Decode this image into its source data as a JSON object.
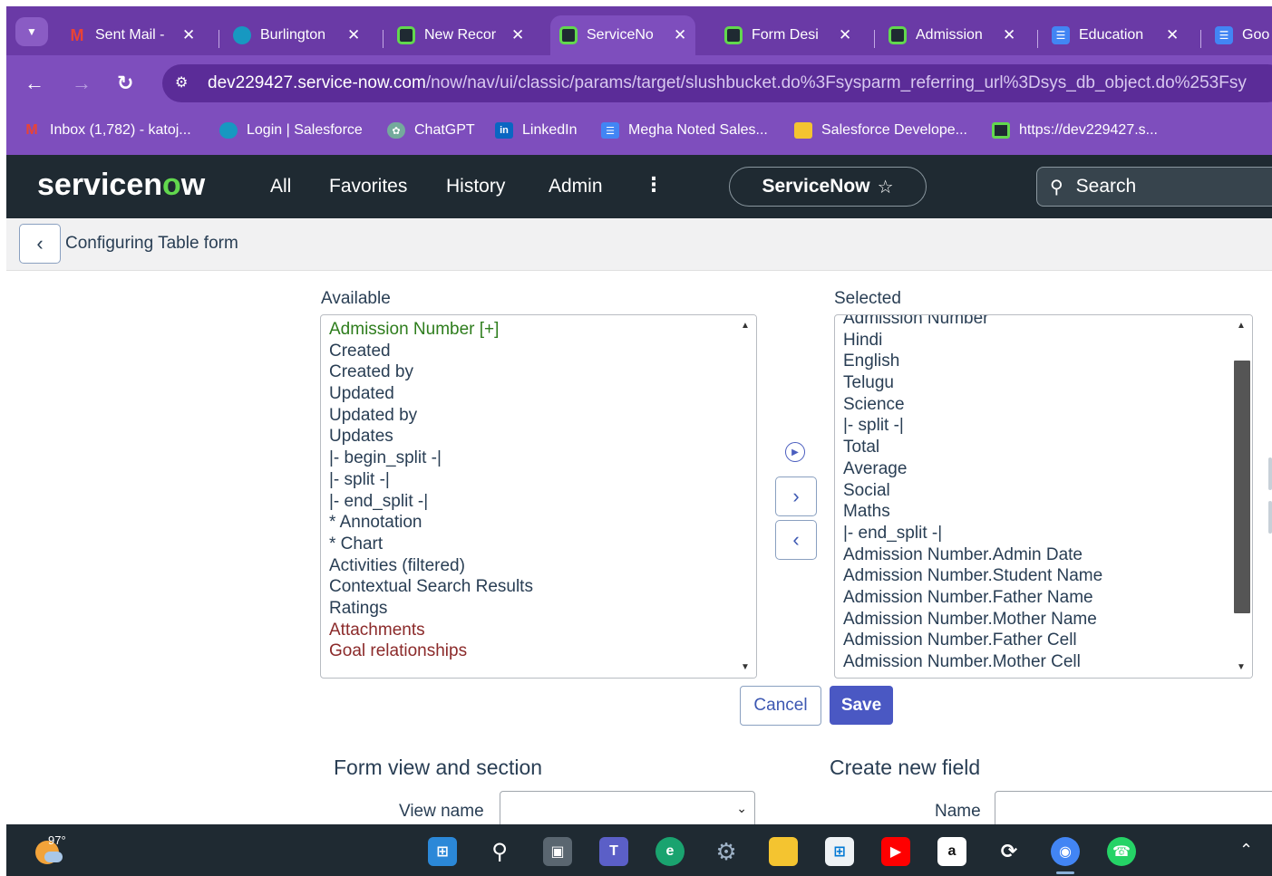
{
  "browser": {
    "tabs": [
      {
        "label": "Sent Mail -",
        "icon": "gmail-icon",
        "color": "#ea4335"
      },
      {
        "label": "Burlington",
        "icon": "salesforce-icon",
        "color": "#1798c1"
      },
      {
        "label": "New Recor",
        "icon": "servicenow-icon",
        "color": "#62d84e"
      },
      {
        "label": "ServiceNo",
        "icon": "servicenow-icon",
        "color": "#62d84e",
        "active": true
      },
      {
        "label": "Form Desi",
        "icon": "servicenow-icon",
        "color": "#62d84e"
      },
      {
        "label": "Admission",
        "icon": "servicenow-icon",
        "color": "#62d84e"
      },
      {
        "label": "Education",
        "icon": "docs-icon",
        "color": "#4285f4"
      },
      {
        "label": "Goo",
        "icon": "docs-icon",
        "color": "#4285f4"
      }
    ],
    "url_host": "dev229427.service-now.com",
    "url_path": "/now/nav/ui/classic/params/target/slushbucket.do%3Fsysparm_referring_url%3Dsys_db_object.do%253Fsy",
    "bookmarks": [
      {
        "label": "Inbox (1,782) - katoj...",
        "icon": "gmail-icon"
      },
      {
        "label": "Login | Salesforce",
        "icon": "salesforce-icon"
      },
      {
        "label": "ChatGPT",
        "icon": "chatgpt-icon"
      },
      {
        "label": "LinkedIn",
        "icon": "linkedin-icon"
      },
      {
        "label": "Megha Noted Sales...",
        "icon": "docs-icon"
      },
      {
        "label": "Salesforce Develope...",
        "icon": "folder-icon"
      },
      {
        "label": "https://dev229427.s...",
        "icon": "servicenow-icon"
      }
    ]
  },
  "header": {
    "logo": "servicenow",
    "nav": [
      "All",
      "Favorites",
      "History",
      "Admin"
    ],
    "instance": "ServiceNow",
    "search_placeholder": "Search"
  },
  "page": {
    "title": "Configuring Table form"
  },
  "slushbucket": {
    "available_label": "Available",
    "selected_label": "Selected",
    "available": [
      {
        "text": "Admission Number [+]",
        "style": "green"
      },
      {
        "text": "Created",
        "style": ""
      },
      {
        "text": "Created by",
        "style": ""
      },
      {
        "text": "Updated",
        "style": ""
      },
      {
        "text": "Updated by",
        "style": ""
      },
      {
        "text": "Updates",
        "style": ""
      },
      {
        "text": "|- begin_split -|",
        "style": ""
      },
      {
        "text": "|- split -|",
        "style": ""
      },
      {
        "text": "|- end_split -|",
        "style": ""
      },
      {
        "text": "* Annotation",
        "style": ""
      },
      {
        "text": "* Chart",
        "style": ""
      },
      {
        "text": "Activities (filtered)",
        "style": ""
      },
      {
        "text": "Contextual Search Results",
        "style": ""
      },
      {
        "text": "Ratings",
        "style": ""
      },
      {
        "text": "Attachments",
        "style": "maroon"
      },
      {
        "text": "Goal relationships",
        "style": "maroon"
      }
    ],
    "selected": [
      "Admission Number",
      "Hindi",
      "English",
      "Telugu",
      "Science",
      "|- split -|",
      "Total",
      "Average",
      "Social",
      "Maths",
      "|- end_split -|",
      "Admission Number.Admin Date",
      "Admission Number.Student Name",
      "Admission Number.Father Name",
      "Admission Number.Mother Name",
      "Admission Number.Father Cell",
      "Admission Number.Mother Cell"
    ],
    "selected_scroll_position": 0.85,
    "cancel_label": "Cancel",
    "save_label": "Save"
  },
  "form_view": {
    "title": "Form view and section",
    "view_name_label": "View name",
    "view_name_value": ""
  },
  "new_field": {
    "title": "Create new field",
    "name_label": "Name",
    "name_value": ""
  },
  "taskbar": {
    "temperature": "97°"
  }
}
